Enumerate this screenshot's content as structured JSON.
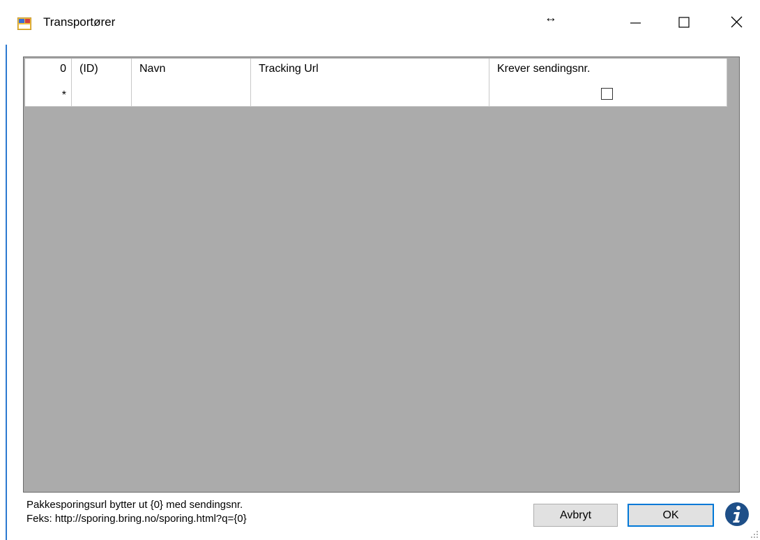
{
  "window": {
    "title": "Transportører",
    "resize_glyph": "↔",
    "controls": [
      "minimize",
      "maximize",
      "close"
    ]
  },
  "grid": {
    "row_header_value": "0",
    "columns": [
      "(ID)",
      "Navn",
      "Tracking Url",
      "Krever sendingsnr."
    ],
    "new_row": {
      "marker": "*",
      "id": "",
      "navn": "",
      "tracking_url": "",
      "krever_sendingsnr": false
    }
  },
  "footer": {
    "hint_line1": "Pakkesporingsurl bytter ut {0} med sendingsnr.",
    "hint_line2": "Feks: http://sporing.bring.no/sporing.html?q={0}",
    "cancel_label": "Avbryt",
    "ok_label": "OK"
  },
  "colors": {
    "grid_background": "#ababab",
    "focus_border": "#0078d7",
    "info_icon": "#1e4f88"
  }
}
